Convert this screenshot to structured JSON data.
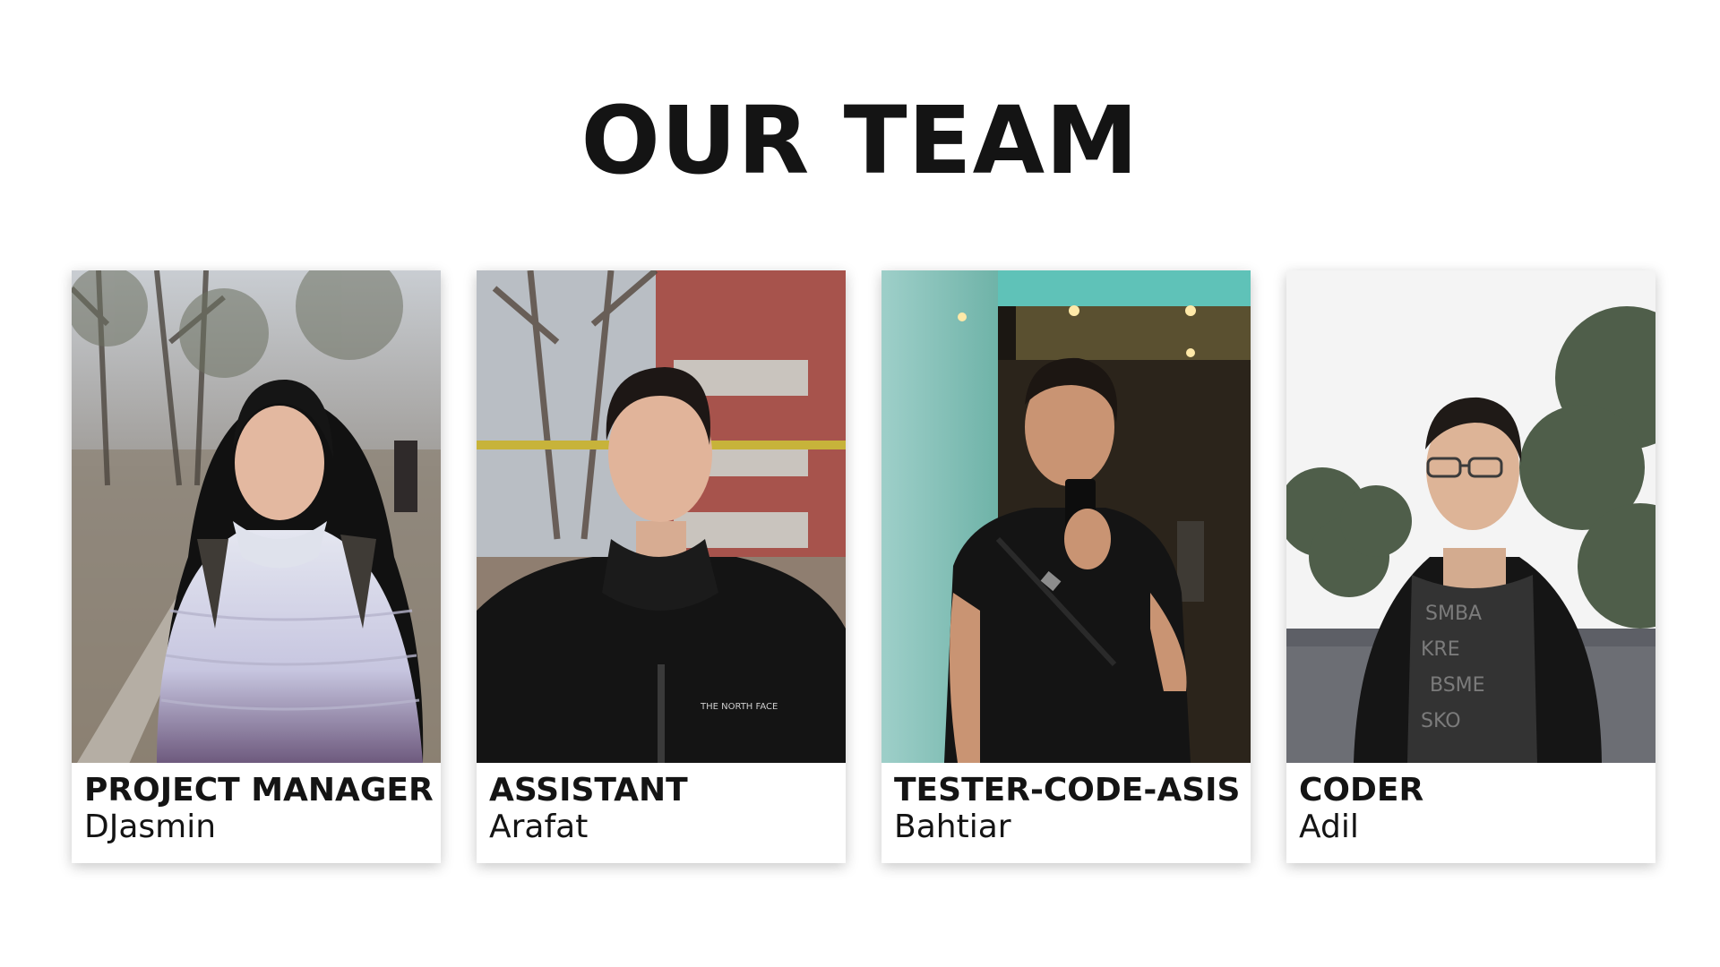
{
  "title": "OUR TEAM",
  "members": [
    {
      "role": "PROJECT MANAGER",
      "name": "DJasmin"
    },
    {
      "role": "ASSISTANT",
      "name": "Arafat"
    },
    {
      "role": "TESTER-CODE-ASIS",
      "name": "Bahtiar"
    },
    {
      "role": "CODER",
      "name": "Adil"
    }
  ]
}
